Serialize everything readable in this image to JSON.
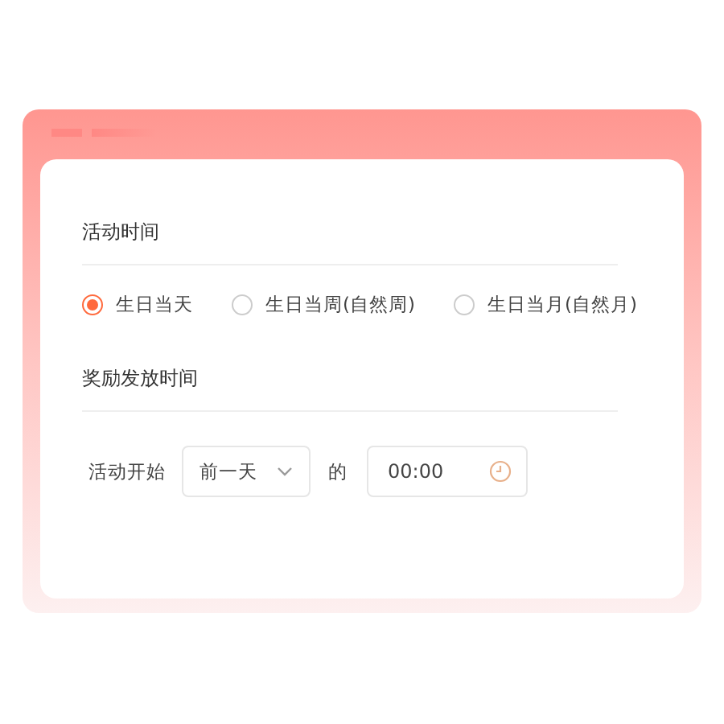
{
  "sections": [
    {
      "title": "活动时间"
    },
    {
      "title": "奖励发放时间"
    }
  ],
  "birthday_options": [
    {
      "label": "生日当天",
      "selected": true
    },
    {
      "label": "生日当周(自然周)",
      "selected": false
    },
    {
      "label": "生日当月(自然月)",
      "selected": false
    }
  ],
  "reward": {
    "label": "活动开始",
    "select_value": "前一天",
    "connector": "的",
    "time_value": "00:00"
  }
}
